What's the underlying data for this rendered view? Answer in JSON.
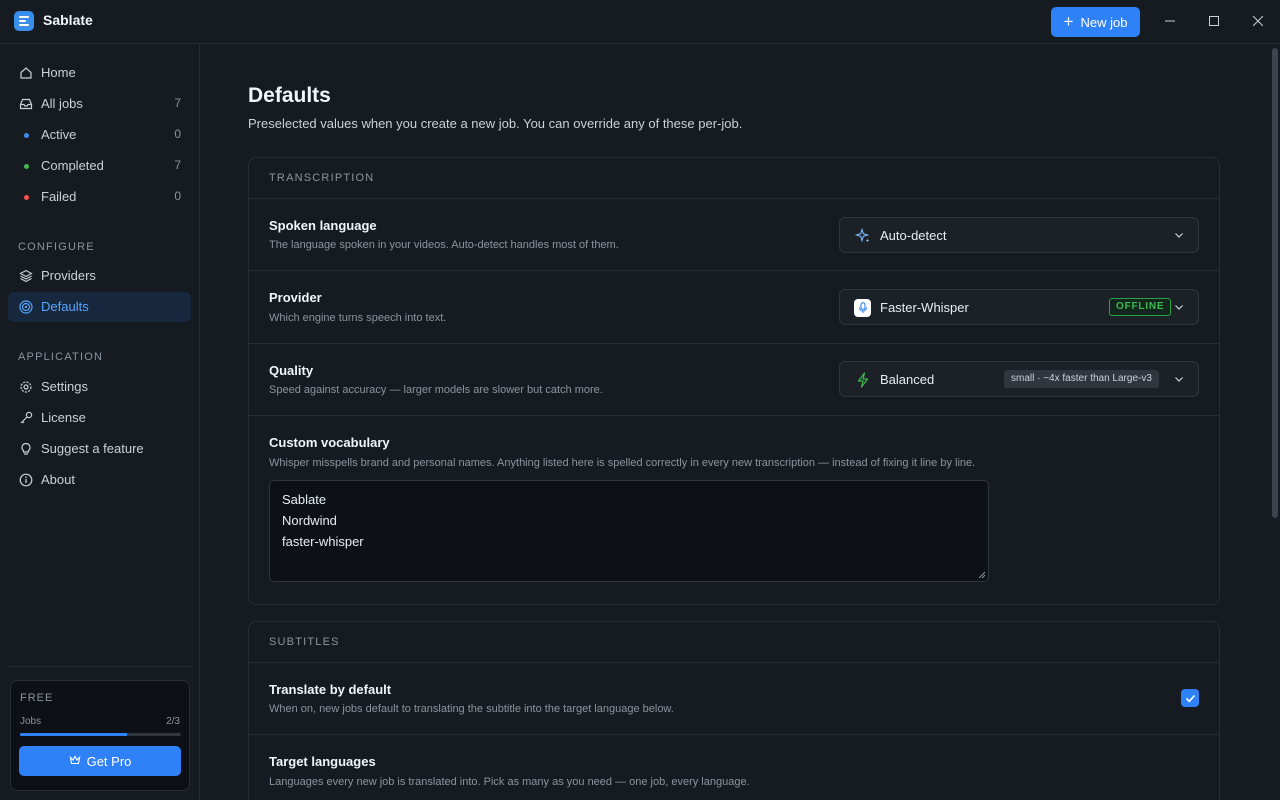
{
  "app": {
    "title": "Sablate",
    "new_job_label": "New job"
  },
  "sidebar": {
    "nav": [
      {
        "label": "Home",
        "icon": "home-icon"
      },
      {
        "label": "All jobs",
        "count": "7",
        "icon": "inbox-icon"
      },
      {
        "label": "Active",
        "count": "0",
        "dot_color": "#3b8eea"
      },
      {
        "label": "Completed",
        "count": "7",
        "dot_color": "#3fb950"
      },
      {
        "label": "Failed",
        "count": "0",
        "dot_color": "#f85149"
      }
    ],
    "configure_label": "CONFIGURE",
    "configure": [
      {
        "label": "Providers",
        "icon": "layers-icon"
      },
      {
        "label": "Defaults",
        "icon": "target-icon",
        "active": true
      }
    ],
    "application_label": "APPLICATION",
    "application": [
      {
        "label": "Settings",
        "icon": "gear-icon"
      },
      {
        "label": "License",
        "icon": "key-icon"
      },
      {
        "label": "Suggest a feature",
        "icon": "lightbulb-icon"
      },
      {
        "label": "About",
        "icon": "info-icon"
      }
    ],
    "plan": {
      "name": "FREE",
      "jobs_label": "Jobs",
      "jobs_count": "2/3",
      "usage_fraction": 0.6667,
      "cta": "Get Pro"
    }
  },
  "main": {
    "title": "Defaults",
    "subtitle": "Preselected values when you create a new job. You can override any of these per-job.",
    "transcription": {
      "heading": "TRANSCRIPTION",
      "spoken_language": {
        "title": "Spoken language",
        "desc": "The language spoken in your videos. Auto-detect handles most of them.",
        "value": "Auto-detect"
      },
      "provider": {
        "title": "Provider",
        "desc": "Which engine turns speech into text.",
        "value": "Faster-Whisper",
        "badge": "OFFLINE"
      },
      "quality": {
        "title": "Quality",
        "desc": "Speed against accuracy — larger models are slower but catch more.",
        "value": "Balanced",
        "badge": "small · ~4x faster than Large-v3"
      },
      "vocabulary": {
        "title": "Custom vocabulary",
        "desc": "Whisper misspells brand and personal names. Anything listed here is spelled correctly in every new transcription — instead of fixing it line by line.",
        "lines": [
          "Sablate",
          "Nordwind",
          "faster-whisper"
        ]
      }
    },
    "subtitles": {
      "heading": "SUBTITLES",
      "translate": {
        "title": "Translate by default",
        "desc": "When on, new jobs default to translating the subtitle into the target language below.",
        "checked": true
      },
      "target_languages": {
        "title": "Target languages",
        "desc": "Languages every new job is translated into. Pick as many as you need — one job, every language."
      }
    }
  },
  "colors": {
    "accent": "#2f81f7",
    "background": "#161b22",
    "offline_green": "#3fb950"
  }
}
